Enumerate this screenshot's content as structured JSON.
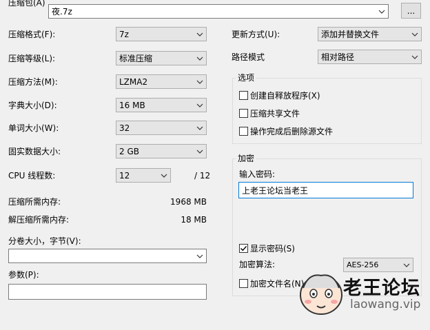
{
  "archive": {
    "label": "压缩包(A)",
    "value": "夜.7z",
    "browse_label": "..."
  },
  "left": {
    "format": {
      "label": "压缩格式(F):",
      "value": "7z"
    },
    "level": {
      "label": "压缩等级(L):",
      "value": "标准压缩"
    },
    "method": {
      "label": "压缩方法(M):",
      "value": "LZMA2"
    },
    "dict": {
      "label": "字典大小(D):",
      "value": "16 MB"
    },
    "word": {
      "label": "单词大小(W):",
      "value": "32"
    },
    "solid": {
      "label": "固实数据大小:",
      "value": "2 GB"
    },
    "threads": {
      "label": "CPU 线程数:",
      "value": "12",
      "total": "/ 12"
    },
    "mem_compress": {
      "label": "压缩所需内存:",
      "value": "1968 MB"
    },
    "mem_decompress": {
      "label": "解压缩所需内存:",
      "value": "18 MB"
    },
    "volume": {
      "label": "分卷大小，字节(V):",
      "value": ""
    },
    "params": {
      "label": "参数(P):",
      "value": ""
    }
  },
  "right": {
    "update": {
      "label": "更新方式(U):",
      "value": "添加并替换文件"
    },
    "path": {
      "label": "路径模式",
      "value": "相对路径"
    },
    "options": {
      "title": "选项",
      "sfx": "创建自释放程序(X)",
      "shared": "压缩共享文件",
      "delete": "操作完成后删除源文件"
    },
    "encryption": {
      "title": "加密",
      "password_label": "输入密码:",
      "password_value": "上老王论坛当老王",
      "show_password": "显示密码(S)",
      "show_password_checked": true,
      "method_label": "加密算法:",
      "method_value": "AES-256",
      "encrypt_names": "加密文件名(N)"
    }
  },
  "watermark": {
    "title": "老王论坛",
    "url": "laowang.vip"
  }
}
